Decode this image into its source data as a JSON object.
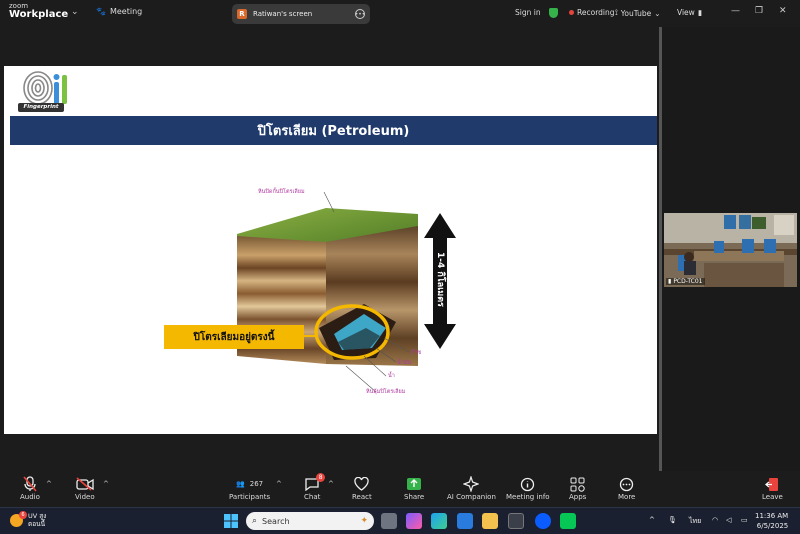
{
  "app": {
    "brand_line1": "zoom",
    "brand_line2": "Workplace",
    "meeting_label": "Meeting"
  },
  "share_pill": {
    "avatar_letter": "R",
    "title": "Ratiwan's screen"
  },
  "top_right": {
    "sign_in": "Sign in",
    "recording": "Recording",
    "youtube": "YouTube",
    "view": "View"
  },
  "slide": {
    "logo_text": "Fingerprint",
    "title": "ปิโตรเลียม (Petroleum)",
    "label_main": "ปิโตรเลียมอยู่ตรงนี้",
    "label_cap": "หินปิดกั้นปิโตรเลียม",
    "label_gas": "ก๊าซ",
    "label_oil": "น้ำมัน",
    "label_water": "น้ำ",
    "label_source": "หินอุ้มปิโตรเลียม",
    "depth": "1-4 กิโลเมตร"
  },
  "participant_video": {
    "name": "PCD-TC01"
  },
  "toolbar": {
    "audio": "Audio",
    "video": "Video",
    "participants": "Participants",
    "participant_count": "267",
    "chat": "Chat",
    "chat_badge": "8",
    "react": "React",
    "share": "Share",
    "ai": "AI Companion",
    "info": "Meeting info",
    "apps": "Apps",
    "more": "More",
    "leave": "Leave"
  },
  "taskbar": {
    "weather_line1": "UV สูง",
    "weather_line2": "ตอนนี้",
    "weather_badge": "6",
    "search_placeholder": "Search",
    "lang": "ไทย",
    "time": "11:36 AM",
    "date": "6/5/2025"
  },
  "colors": {
    "banner": "#1f3a6b",
    "label": "#f5b800",
    "zoom_blue": "#0b5cff",
    "green": "#35b34a"
  }
}
